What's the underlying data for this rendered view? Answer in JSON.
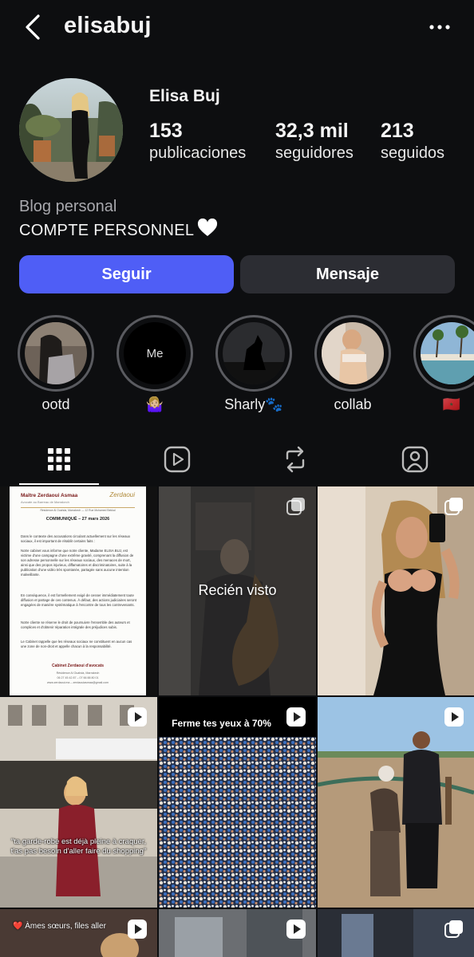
{
  "header": {
    "username": "elisabuj"
  },
  "profile": {
    "display_name": "Elisa Buj",
    "stats": {
      "posts_count": "153",
      "posts_label": "publicaciones",
      "followers_count": "32,3 mil",
      "followers_label": "seguidores",
      "following_count": "213",
      "following_label": "seguidos"
    },
    "category": "Blog personal",
    "bio": "COMPTE PERSONNEL",
    "bio_emoji": "white-heart"
  },
  "actions": {
    "follow_label": "Seguir",
    "message_label": "Mensaje",
    "follow_color": "#4f5ef6"
  },
  "highlights": [
    {
      "label": "ootd"
    },
    {
      "label": "🤷🏼‍♀️",
      "cover_text": "Me"
    },
    {
      "label": "Sharly🐾"
    },
    {
      "label": "collab"
    },
    {
      "label": "🇲🇦"
    }
  ],
  "tabs": [
    "grid-icon",
    "reels-icon",
    "reposts-icon",
    "tagged-icon"
  ],
  "posts": {
    "doc": {
      "firm": "Maître Zerdaoui Asmaa",
      "firm_sub": "Avocate au Barreau de Marrakech",
      "logo": "Zerdaoui",
      "address": "Résidence Al Ouahda, Marrakech — 12 Rue Mohamed Bekkal",
      "title": "COMMUNIQUÉ – 27 mars 2026",
      "p1": "Dans le contexte des accusations circulant actuellement sur les réseaux sociaux, il est important de rétablir certains faits :",
      "p2": "Notre cabinet vous informe que notre cliente, Madame ELISA BUJ, est victime d'une campagne d'une extrême gravité, comprenant la diffusion de son adresse personnelle sur les réseaux sociaux, des menaces de mort, ainsi que des propos injurieux, diffamatoires et discriminatoires, suite à la publication d'une vidéo très spontanée, partagée sans aucune intention malveillante.",
      "p3": "En conséquence, il est formellement exigé de cesser immédiatement toute diffusion et partage de ces contenus. À défaut, des actions judiciaires seront engagées de manière systématique à l'encontre de tous les contrevenants.",
      "p4": "Notre cliente se réserve le droit de poursuivre l'ensemble des auteurs et complices et d'obtenir réparation intégrale des préjudices subis.",
      "p5": "Le Cabinet rappelle que les réseaux sociaux ne constituent en aucun cas une zone de non-droit et appelle chacun à la responsabilité.",
      "signature": "Cabinet Zerdaoui d'avocats",
      "footer1": "Résidence Al Ouahda, Marrakech",
      "footer2": "06 27 45 42 87 – 07 66 88 80 01",
      "footer3": "www.zerdaoui.ma – zerdaouiasmaa@gmail.com"
    },
    "seen_label": "Recién visto",
    "shopping_caption": "\"ta garde-robe est déjà pleine à craquer, t'as pas besoin d'aller faire du shopping\"",
    "crowd_caption": "Ferme tes yeux à 70%",
    "partial_caption": "❤️ Àmes sœurs, files aller"
  }
}
